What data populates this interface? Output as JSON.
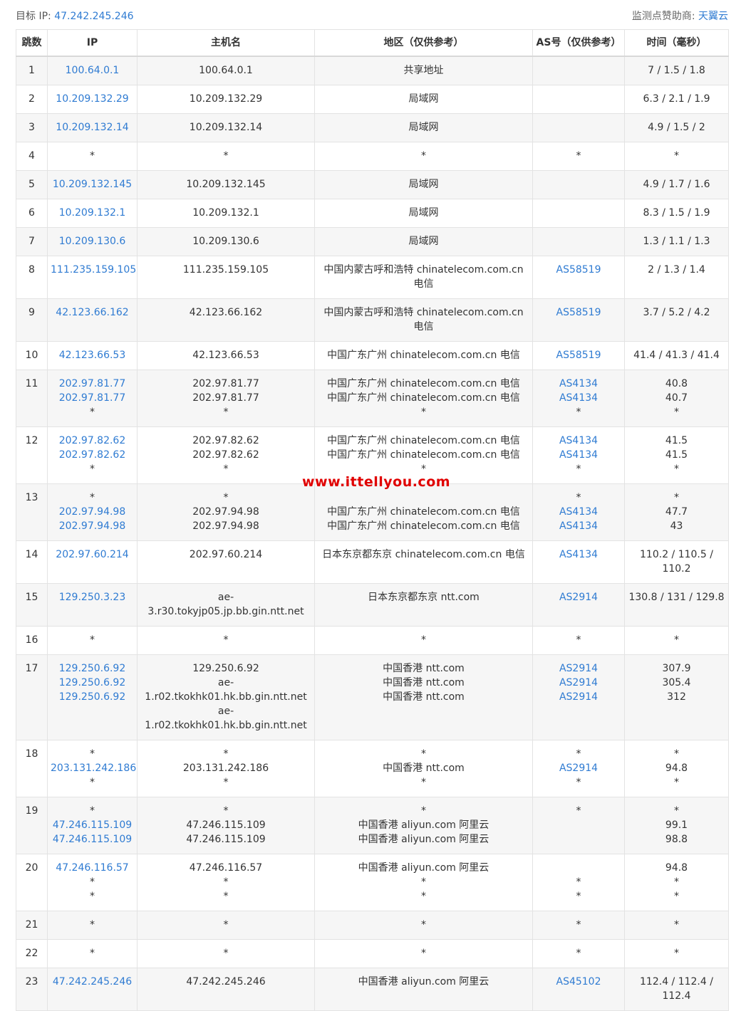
{
  "header": {
    "target_label": "目标 IP:",
    "target_ip": "47.242.245.246",
    "sponsor_label": "监测点赞助商:",
    "sponsor_name": "天翼云"
  },
  "columns": [
    "跳数",
    "IP",
    "主机名",
    "地区（仅供参考）",
    "AS号（仅供参考）",
    "时间（毫秒）"
  ],
  "rows": [
    {
      "hop": "1",
      "ips": [
        "100.64.0.1"
      ],
      "hosts": [
        "100.64.0.1"
      ],
      "regions": [
        "共享地址"
      ],
      "as": [
        ""
      ],
      "times": [
        "7 / 1.5 / 1.8"
      ]
    },
    {
      "hop": "2",
      "ips": [
        "10.209.132.29"
      ],
      "hosts": [
        "10.209.132.29"
      ],
      "regions": [
        "局域网"
      ],
      "as": [
        ""
      ],
      "times": [
        "6.3 / 2.1 / 1.9"
      ]
    },
    {
      "hop": "3",
      "ips": [
        "10.209.132.14"
      ],
      "hosts": [
        "10.209.132.14"
      ],
      "regions": [
        "局域网"
      ],
      "as": [
        ""
      ],
      "times": [
        "4.9 / 1.5 / 2"
      ]
    },
    {
      "hop": "4",
      "ips": [
        "*"
      ],
      "hosts": [
        "*"
      ],
      "regions": [
        "*"
      ],
      "as": [
        "*"
      ],
      "times": [
        "*"
      ]
    },
    {
      "hop": "5",
      "ips": [
        "10.209.132.145"
      ],
      "hosts": [
        "10.209.132.145"
      ],
      "regions": [
        "局域网"
      ],
      "as": [
        ""
      ],
      "times": [
        "4.9 / 1.7 / 1.6"
      ]
    },
    {
      "hop": "6",
      "ips": [
        "10.209.132.1"
      ],
      "hosts": [
        "10.209.132.1"
      ],
      "regions": [
        "局域网"
      ],
      "as": [
        ""
      ],
      "times": [
        "8.3 / 1.5 / 1.9"
      ]
    },
    {
      "hop": "7",
      "ips": [
        "10.209.130.6"
      ],
      "hosts": [
        "10.209.130.6"
      ],
      "regions": [
        "局域网"
      ],
      "as": [
        ""
      ],
      "times": [
        "1.3 / 1.1 / 1.3"
      ]
    },
    {
      "hop": "8",
      "ips": [
        "111.235.159.105"
      ],
      "hosts": [
        "111.235.159.105"
      ],
      "regions": [
        "中国内蒙古呼和浩特 chinatelecom.com.cn 电信"
      ],
      "as": [
        "AS58519"
      ],
      "times": [
        "2 / 1.3 / 1.4"
      ]
    },
    {
      "hop": "9",
      "ips": [
        "42.123.66.162"
      ],
      "hosts": [
        "42.123.66.162"
      ],
      "regions": [
        "中国内蒙古呼和浩特 chinatelecom.com.cn 电信"
      ],
      "as": [
        "AS58519"
      ],
      "times": [
        "3.7 / 5.2 / 4.2"
      ]
    },
    {
      "hop": "10",
      "ips": [
        "42.123.66.53"
      ],
      "hosts": [
        "42.123.66.53"
      ],
      "regions": [
        "中国广东广州 chinatelecom.com.cn 电信"
      ],
      "as": [
        "AS58519"
      ],
      "times": [
        "41.4 / 41.3 / 41.4"
      ]
    },
    {
      "hop": "11",
      "ips": [
        "202.97.81.77",
        "202.97.81.77",
        "*"
      ],
      "hosts": [
        "202.97.81.77",
        "202.97.81.77",
        "*"
      ],
      "regions": [
        "中国广东广州 chinatelecom.com.cn 电信",
        "中国广东广州 chinatelecom.com.cn 电信",
        "*"
      ],
      "as": [
        "AS4134",
        "AS4134",
        "*"
      ],
      "times": [
        "40.8",
        "40.7",
        "*"
      ]
    },
    {
      "hop": "12",
      "ips": [
        "202.97.82.62",
        "202.97.82.62",
        "*"
      ],
      "hosts": [
        "202.97.82.62",
        "202.97.82.62",
        "*"
      ],
      "regions": [
        "中国广东广州 chinatelecom.com.cn 电信",
        "中国广东广州 chinatelecom.com.cn 电信",
        "*"
      ],
      "as": [
        "AS4134",
        "AS4134",
        "*"
      ],
      "times": [
        "41.5",
        "41.5",
        "*"
      ]
    },
    {
      "hop": "13",
      "ips": [
        "*",
        "202.97.94.98",
        "202.97.94.98"
      ],
      "hosts": [
        "*",
        "202.97.94.98",
        "202.97.94.98"
      ],
      "regions": [
        "",
        "中国广东广州 chinatelecom.com.cn 电信",
        "中国广东广州 chinatelecom.com.cn 电信"
      ],
      "as": [
        "*",
        "AS4134",
        "AS4134"
      ],
      "times": [
        "*",
        "47.7",
        "43"
      ]
    },
    {
      "hop": "14",
      "ips": [
        "202.97.60.214"
      ],
      "hosts": [
        "202.97.60.214"
      ],
      "regions": [
        "日本东京都东京 chinatelecom.com.cn 电信"
      ],
      "as": [
        "AS4134"
      ],
      "times": [
        "110.2 / 110.5 / 110.2"
      ]
    },
    {
      "hop": "15",
      "ips": [
        "129.250.3.23"
      ],
      "hosts": [
        "ae-3.r30.tokyjp05.jp.bb.gin.ntt.net"
      ],
      "regions": [
        "日本东京都东京 ntt.com"
      ],
      "as": [
        "AS2914"
      ],
      "times": [
        "130.8 / 131 / 129.8"
      ]
    },
    {
      "hop": "16",
      "ips": [
        "*"
      ],
      "hosts": [
        "*"
      ],
      "regions": [
        "*"
      ],
      "as": [
        "*"
      ],
      "times": [
        "*"
      ]
    },
    {
      "hop": "17",
      "ips": [
        "129.250.6.92",
        "129.250.6.92",
        "129.250.6.92"
      ],
      "hosts": [
        "129.250.6.92",
        "ae-1.r02.tkokhk01.hk.bb.gin.ntt.net",
        "ae-1.r02.tkokhk01.hk.bb.gin.ntt.net"
      ],
      "regions": [
        "中国香港 ntt.com",
        "中国香港 ntt.com",
        "中国香港 ntt.com"
      ],
      "as": [
        "AS2914",
        "AS2914",
        "AS2914"
      ],
      "times": [
        "307.9",
        "305.4",
        "312"
      ]
    },
    {
      "hop": "18",
      "ips": [
        "*",
        "203.131.242.186",
        "*"
      ],
      "hosts": [
        "*",
        "203.131.242.186",
        "*"
      ],
      "regions": [
        "*",
        "中国香港 ntt.com",
        "*"
      ],
      "as": [
        "*",
        "AS2914",
        "*"
      ],
      "times": [
        "*",
        "94.8",
        "*"
      ]
    },
    {
      "hop": "19",
      "ips": [
        "*",
        "47.246.115.109",
        "47.246.115.109"
      ],
      "hosts": [
        "*",
        "47.246.115.109",
        "47.246.115.109"
      ],
      "regions": [
        "*",
        "中国香港 aliyun.com 阿里云",
        "中国香港 aliyun.com 阿里云"
      ],
      "as": [
        "*"
      ],
      "times": [
        "*",
        "99.1",
        "98.8"
      ]
    },
    {
      "hop": "20",
      "ips": [
        "47.246.116.57",
        "*",
        "*"
      ],
      "hosts": [
        "47.246.116.57",
        "*",
        "*"
      ],
      "regions": [
        "中国香港 aliyun.com 阿里云",
        "*",
        "*"
      ],
      "as": [
        "",
        "*",
        "*"
      ],
      "times": [
        "94.8",
        "*",
        "*"
      ]
    },
    {
      "hop": "21",
      "ips": [
        "*"
      ],
      "hosts": [
        "*"
      ],
      "regions": [
        "*"
      ],
      "as": [
        "*"
      ],
      "times": [
        "*"
      ]
    },
    {
      "hop": "22",
      "ips": [
        "*"
      ],
      "hosts": [
        "*"
      ],
      "regions": [
        "*"
      ],
      "as": [
        "*"
      ],
      "times": [
        "*"
      ]
    },
    {
      "hop": "23",
      "ips": [
        "47.242.245.246"
      ],
      "hosts": [
        "47.242.245.246"
      ],
      "regions": [
        "中国香港 aliyun.com 阿里云"
      ],
      "as": [
        "AS45102"
      ],
      "times": [
        "112.4 / 112.4 / 112.4"
      ]
    }
  ],
  "watermark": "www.ittellyou.com"
}
